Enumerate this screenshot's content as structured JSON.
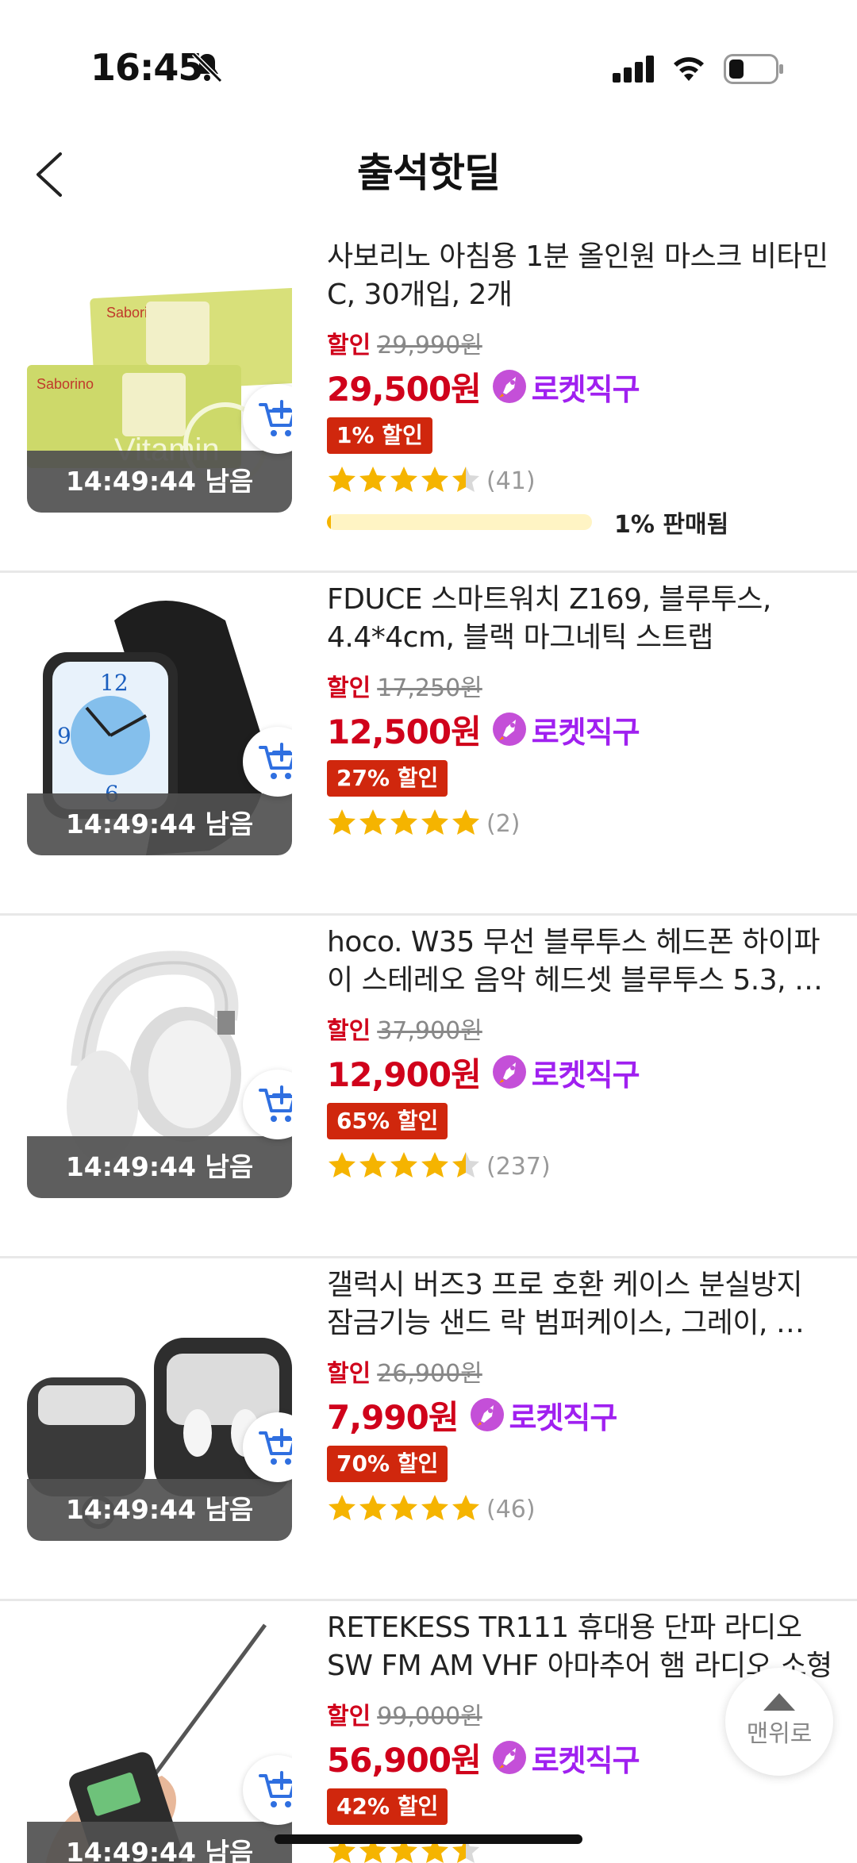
{
  "status_bar": {
    "time": "16:45"
  },
  "header": {
    "title": "출석핫딜"
  },
  "items": [
    {
      "name": "사보리노 아침용 1분 올인원 마스크 비타민 C, 30개입, 2개",
      "sale_label": "할인",
      "original_price": "29,990원",
      "price": "29,500원",
      "delivery": "로켓직구",
      "discount": "1% 할인",
      "rating": 4.5,
      "reviews": "(41)",
      "timer": "14:49:44 남음",
      "sold_fraction": 0.01,
      "sold_text": "1% 판매됨",
      "image": "mask-pack-image"
    },
    {
      "name": "FDUCE 스마트워치 Z169, 블루투스, 4.4*4cm, 블랙 마그네틱 스트랩",
      "sale_label": "할인",
      "original_price": "17,250원",
      "price": "12,500원",
      "delivery": "로켓직구",
      "discount": "27% 할인",
      "rating": 5,
      "reviews": "(2)",
      "timer": "14:49:44 남음",
      "image": "smartwatch-image"
    },
    {
      "name": "hoco. W35 무선 블루투스 헤드폰 하이파이 스테레오 음악 헤드셋 블루투스 5.3, …",
      "sale_label": "할인",
      "original_price": "37,900원",
      "price": "12,900원",
      "delivery": "로켓직구",
      "discount": "65% 할인",
      "rating": 4.5,
      "reviews": "(237)",
      "timer": "14:49:44 남음",
      "image": "headphones-image"
    },
    {
      "name": "갤럭시 버즈3 프로 호환 케이스 분실방지 잠금기능 샌드 락 범퍼케이스, 그레이, …",
      "sale_label": "할인",
      "original_price": "26,900원",
      "price": "7,990원",
      "delivery": "로켓직구",
      "discount": "70% 할인",
      "rating": 5,
      "reviews": "(46)",
      "timer": "14:49:44 남음",
      "image": "earbuds-case-image"
    },
    {
      "name": "RETEKESS TR111 휴대용 단파 라디오 SW FM AM VHF 아마추어 햄 라디오 소형 …",
      "sale_label": "할인",
      "original_price": "99,000원",
      "price": "56,900원",
      "delivery": "로켓직구",
      "discount": "42% 할인",
      "rating": 4.5,
      "reviews": "",
      "timer": "14:49:44 남음",
      "image": "radio-image"
    }
  ],
  "top_button": {
    "label": "맨위로"
  },
  "colors": {
    "accent": "#d0021b",
    "rocket": "#a020f0",
    "star": "#f5b400",
    "badge": "#d0270d"
  }
}
